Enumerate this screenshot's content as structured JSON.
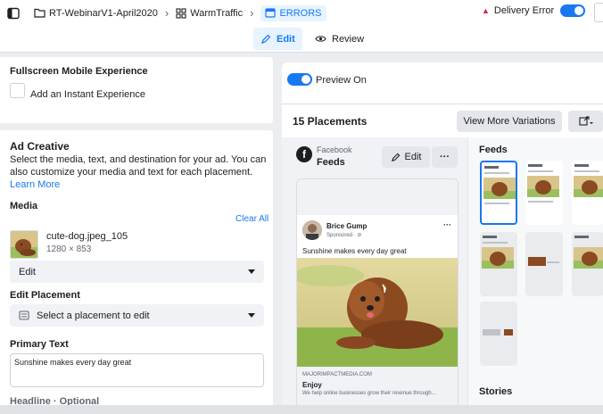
{
  "breadcrumb": {
    "campaign": "RT-WebinarV1-April2020",
    "adset": "WarmTraffic",
    "ad": "ERRORS"
  },
  "status": {
    "delivery_error": "Delivery Error"
  },
  "modes": {
    "edit": "Edit",
    "review": "Review"
  },
  "fullscreen": {
    "title": "Fullscreen Mobile Experience",
    "checkbox_label": "Add an Instant Experience"
  },
  "ad_creative": {
    "title": "Ad Creative",
    "description": "Select the media, text, and destination for your ad. You can also customize your media and text for each placement.",
    "learn_more": "Learn More",
    "media_label": "Media",
    "clear_all": "Clear All",
    "file_name": "cute-dog.jpeg_105",
    "file_dims": "1280 × 853",
    "edit_select": "Edit",
    "edit_placement_label": "Edit Placement",
    "placement_select": "Select a placement to edit",
    "primary_text_label": "Primary Text",
    "primary_text_value": "Sunshine makes every day great",
    "headline_label": "Headline · Optional"
  },
  "preview": {
    "toggle_label": "Preview On",
    "placements_title": "15 Placements",
    "view_more": "View More Variations",
    "platform": "Facebook",
    "placement": "Feeds",
    "edit": "Edit",
    "more": "···",
    "post": {
      "author": "Brice Gump",
      "sponsored": "Sponsored · ⊘",
      "text": "Sunshine makes every day great",
      "domain": "MAJORIMPACTMEDIA.COM",
      "link_title": "Enjoy",
      "link_desc": "We help online businesses grow their revenue through..."
    },
    "sections": {
      "feeds": "Feeds",
      "stories": "Stories"
    }
  },
  "colors": {
    "accent": "#1877f2",
    "error": "#e41e3f"
  }
}
